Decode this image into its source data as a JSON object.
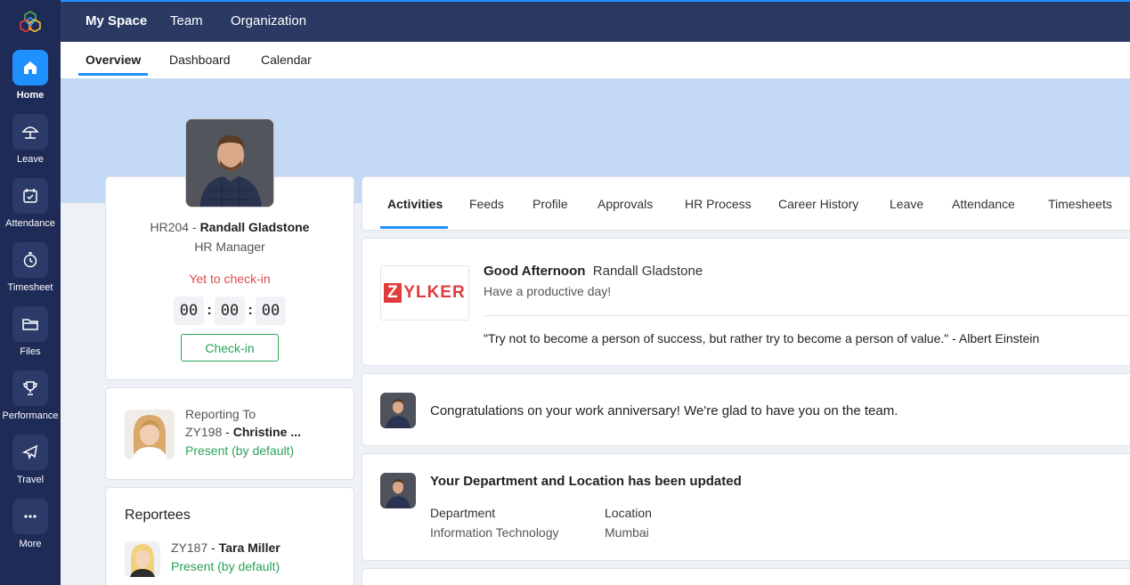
{
  "sidebar": {
    "items": [
      {
        "label": "Home",
        "icon": "home-icon"
      },
      {
        "label": "Leave",
        "icon": "umbrella-icon"
      },
      {
        "label": "Attendance",
        "icon": "calendar-check-icon"
      },
      {
        "label": "Timesheet",
        "icon": "stopwatch-icon"
      },
      {
        "label": "Files",
        "icon": "folder-icon"
      },
      {
        "label": "Performance",
        "icon": "trophy-icon"
      },
      {
        "label": "Travel",
        "icon": "airplane-icon"
      },
      {
        "label": "More",
        "icon": "more-icon"
      }
    ]
  },
  "top_tabs": [
    "My Space",
    "Team",
    "Organization"
  ],
  "sub_tabs": [
    "Overview",
    "Dashboard",
    "Calendar"
  ],
  "profile": {
    "id": "HR204",
    "name": "Randall Gladstone",
    "role": "HR Manager",
    "status": "Yet to check-in",
    "timer": [
      "00",
      "00",
      "00"
    ],
    "checkin_label": "Check-in"
  },
  "reporting": {
    "title": "Reporting To",
    "id": "ZY198",
    "name": "Christine ...",
    "status": "Present (by default)"
  },
  "reportees": {
    "title": "Reportees",
    "items": [
      {
        "id": "ZY187",
        "name": "Tara Miller",
        "status": "Present (by default)"
      }
    ]
  },
  "activity_tabs": [
    "Activities",
    "Feeds",
    "Profile",
    "Approvals",
    "HR Process",
    "Career History",
    "Leave",
    "Attendance",
    "Timesheets"
  ],
  "greeting": {
    "brand": "ZYLKER",
    "salutation": "Good Afternoon",
    "name": "Randall Gladstone",
    "subtitle": "Have a productive day!",
    "quote": "\"Try not to become a person of success, but rather try to become a person of value.\" - Albert Einstein"
  },
  "anniversary": {
    "text": "Congratulations on your work anniversary! We're glad to have you on the team."
  },
  "update": {
    "title": "Your Department and Location has been updated",
    "dept_label": "Department",
    "dept_value": "Information Technology",
    "loc_label": "Location",
    "loc_value": "Mumbai"
  },
  "colors": {
    "sidebar": "#1e2b57",
    "topbar": "#2a3a63",
    "accent": "#1e90ff",
    "banner": "#c4d9f5",
    "present": "#29a35a",
    "alert": "#e04b4b"
  }
}
